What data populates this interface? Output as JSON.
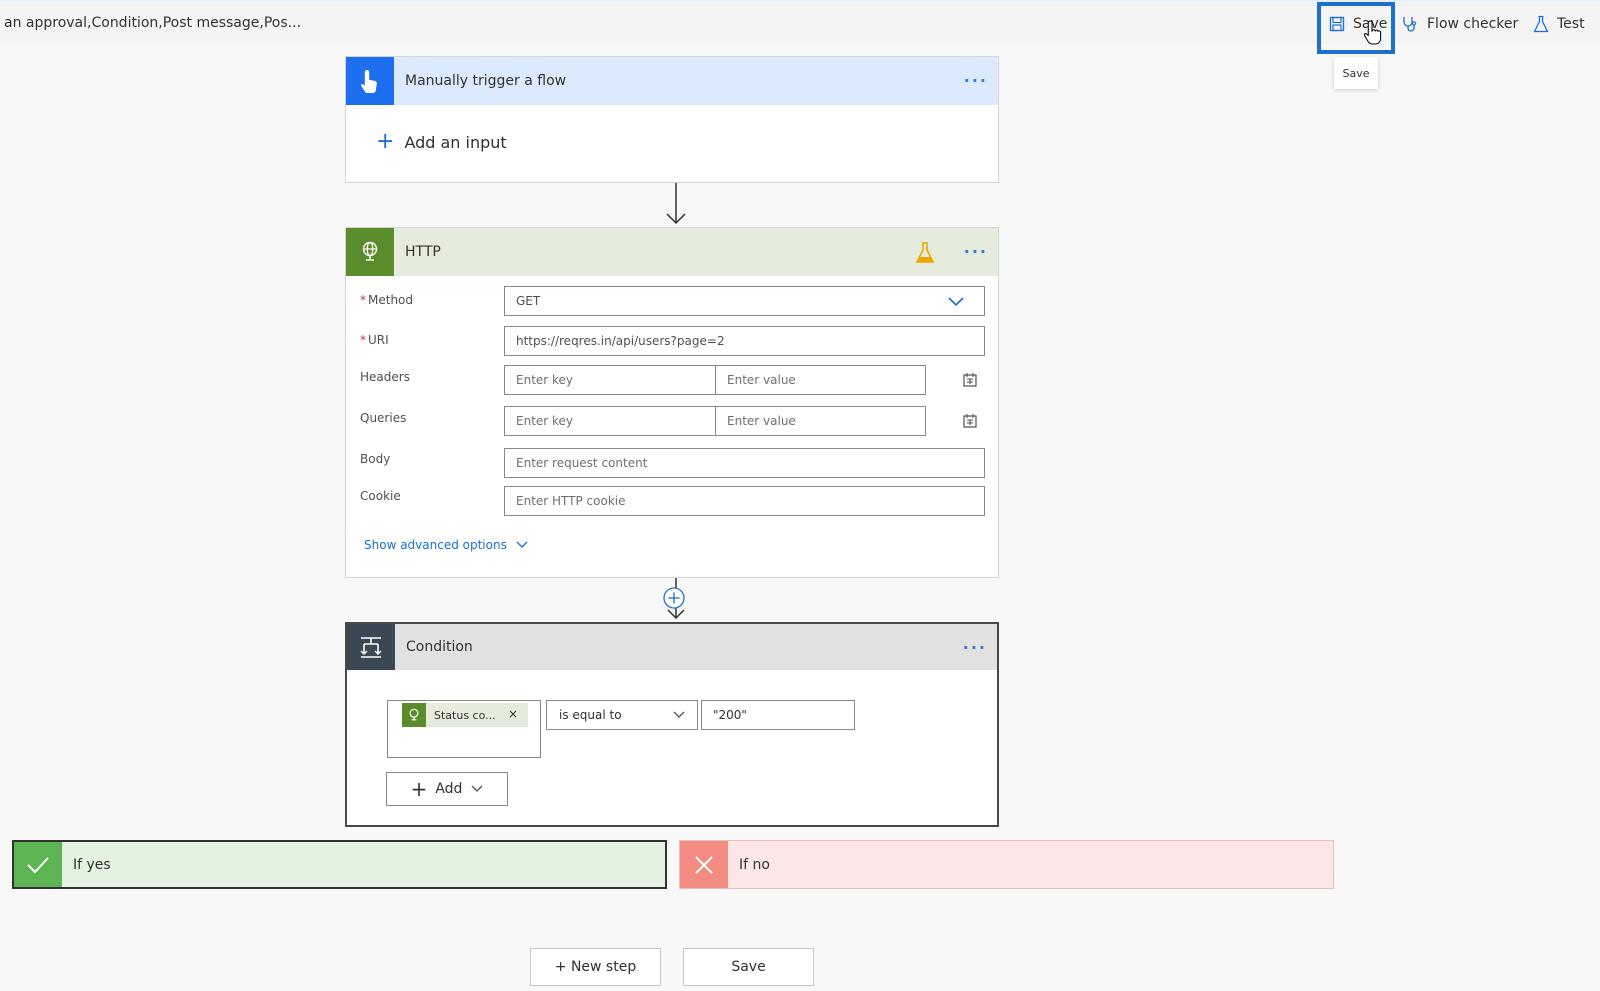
{
  "header": {
    "title": "an approval,Condition,Post message,Pos...",
    "save_label": "Save",
    "flow_checker_label": "Flow checker",
    "test_label": "Test",
    "tooltip": "Save"
  },
  "trigger": {
    "name": "Manually trigger a flow",
    "add_input_label": "Add an input"
  },
  "http": {
    "name": "HTTP",
    "method_label": "Method",
    "method_value": "GET",
    "uri_label": "URI",
    "uri_value": "https://reqres.in/api/users?page=2",
    "headers_label": "Headers",
    "headers_key_placeholder": "Enter key",
    "headers_value_placeholder": "Enter value",
    "queries_label": "Queries",
    "queries_key_placeholder": "Enter key",
    "queries_value_placeholder": "Enter value",
    "body_label": "Body",
    "body_placeholder": "Enter request content",
    "cookie_label": "Cookie",
    "cookie_placeholder": "Enter HTTP cookie",
    "advanced_label": "Show advanced options"
  },
  "condition": {
    "name": "Condition",
    "token_label": "Status co...",
    "operator": "is equal to",
    "value": "\"200\"",
    "add_label": "Add"
  },
  "branches": {
    "yes_label": "If yes",
    "no_label": "If no"
  },
  "footer": {
    "new_step_label": "+ New step",
    "save_label": "Save"
  },
  "colors": {
    "accent": "#1a6fd1",
    "trigger_icon_bg": "#1d6ff0",
    "http_icon_bg": "#5b8c2b",
    "condition_icon_bg": "#3b4752",
    "yes_bg": "#e4f2e2",
    "no_bg": "#fde7e6"
  }
}
